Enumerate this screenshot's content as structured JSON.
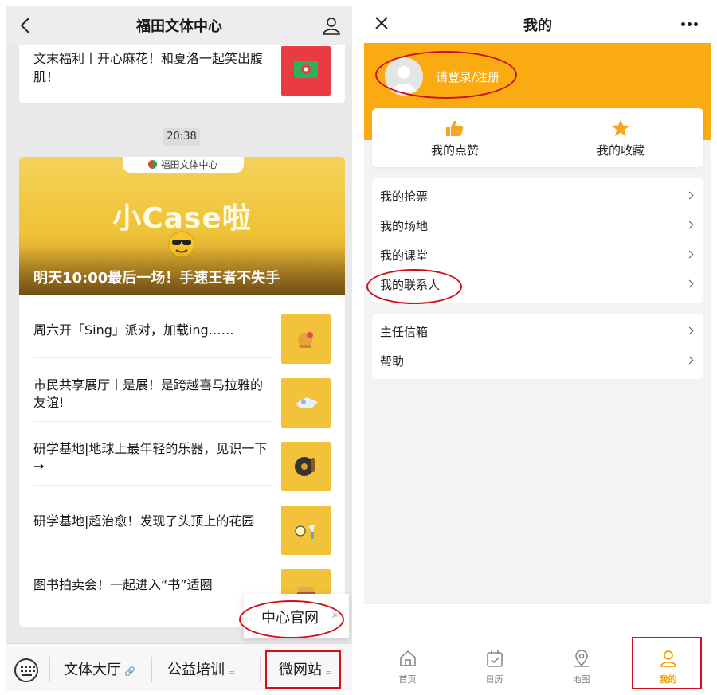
{
  "left": {
    "nav": {
      "title": "福田文体中心"
    },
    "top_article": {
      "title": "文末福利丨开心麻花！和夏洛一起笑出腹肌！"
    },
    "timestamp": "20:38",
    "banner": {
      "tag": "福田文体中心",
      "big_text": "小Case啦",
      "headline": "明天10:00最后一场！手速王者不失手"
    },
    "articles": [
      {
        "title": "周六开「Sing」派对，加载ing……"
      },
      {
        "title": "市民共享展厅丨是展！是跨越喜马拉雅的友谊!"
      },
      {
        "title": "研学基地|地球上最年轻的乐器，见识一下→"
      },
      {
        "title": "研学基地|超治愈！发现了头顶上的花园"
      },
      {
        "title": "图书拍卖会！一起进入“书”适圈"
      }
    ],
    "popup": {
      "label": "中心官网"
    },
    "menu": [
      {
        "label": "文体大厅",
        "mark": "🔗"
      },
      {
        "label": "公益培训",
        "mark": "≡"
      },
      {
        "label": "微网站",
        "mark": "≡"
      }
    ]
  },
  "right": {
    "nav": {
      "title": "我的"
    },
    "login_text": "请登录/注册",
    "quick": [
      {
        "label": "我的点赞",
        "icon": "thumbs-up-icon",
        "color": "#f5a623"
      },
      {
        "label": "我的收藏",
        "icon": "star-icon",
        "color": "#f5a623"
      }
    ],
    "list1": [
      {
        "label": "我的抢票"
      },
      {
        "label": "我的场地"
      },
      {
        "label": "我的课堂"
      },
      {
        "label": "我的联系人"
      }
    ],
    "list2": [
      {
        "label": "主任信箱"
      },
      {
        "label": "帮助"
      }
    ],
    "tabs": [
      {
        "label": "首页",
        "icon": "home-icon"
      },
      {
        "label": "日历",
        "icon": "calendar-icon"
      },
      {
        "label": "地图",
        "icon": "map-icon"
      },
      {
        "label": "我的",
        "icon": "person-icon",
        "active": true
      }
    ],
    "accent": "#fbab12"
  }
}
